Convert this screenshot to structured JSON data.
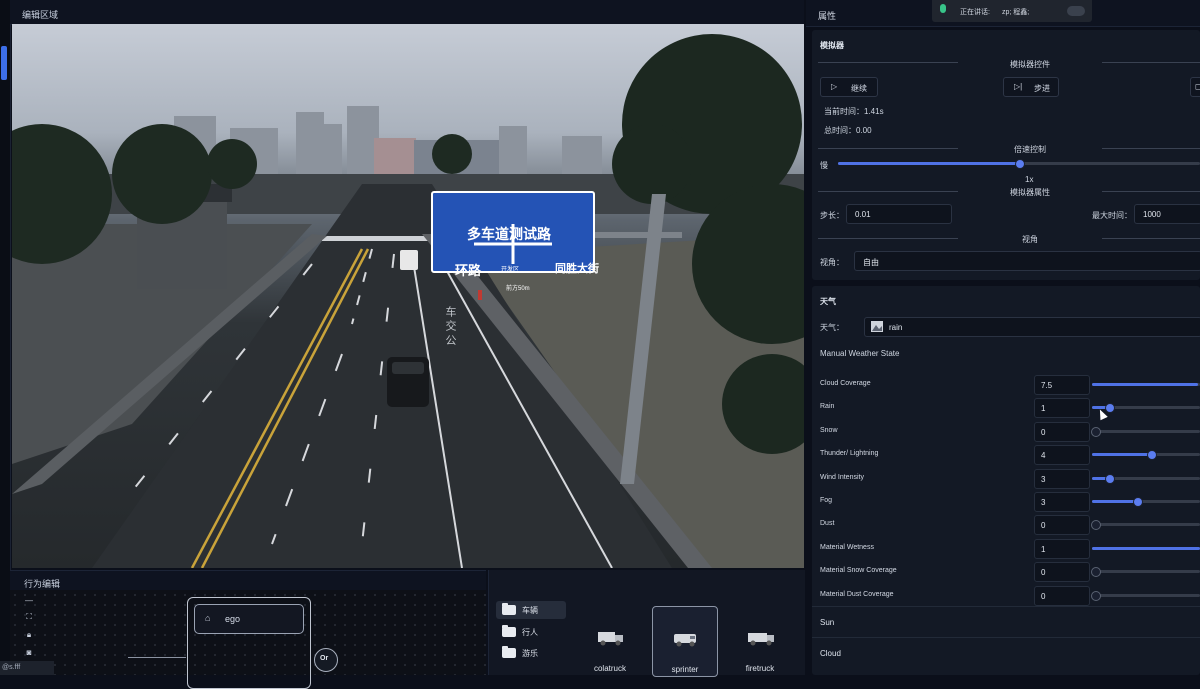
{
  "editor": {
    "title": "编辑区域"
  },
  "sign": {
    "title": "多车道测试路",
    "left": "环路",
    "right": "同胜大街",
    "center": "开发区",
    "bottom": "前方50m"
  },
  "road_text": "车 交 公",
  "behavior": {
    "title": "行为编辑",
    "node_label": "ego",
    "or_label": "Or",
    "tools": [
      "minus-icon",
      "fit-screen-icon",
      "lock-icon",
      "camera-icon"
    ]
  },
  "corner_tag": "@s.fff",
  "assets": {
    "categories": [
      {
        "label": "车辆",
        "selected": true
      },
      {
        "label": "行人",
        "selected": false
      },
      {
        "label": "游乐",
        "selected": false
      }
    ],
    "items": [
      {
        "name": "colatruck",
        "selected": false
      },
      {
        "name": "sprinter",
        "selected": true
      },
      {
        "name": "firetruck",
        "selected": false
      }
    ]
  },
  "properties": {
    "title": "属性",
    "speaking": {
      "label": "正在讲话:",
      "name": "zp; 程鑫;"
    }
  },
  "simulator": {
    "title": "模拟器",
    "controls_title": "模拟器控件",
    "continue_label": "继续",
    "step_label": "步进",
    "current_time": "当前时间：1.41s",
    "total_time": "总时间：0.00",
    "speed_title": "倍速控制",
    "slow_label": "慢",
    "speed_value": "1x",
    "speed_fraction": 0.5,
    "props_title": "模拟器属性",
    "step_size_label": "步长：",
    "step_size": "0.01",
    "max_time_label": "最大时间：",
    "max_time": "1000",
    "view_title": "视角",
    "view_label": "视角：",
    "view_value": "自由"
  },
  "weather": {
    "title": "天气",
    "weather_label": "天气：",
    "weather_value": "rain",
    "manual_title": "Manual Weather State",
    "params": [
      {
        "label": "Cloud Coverage",
        "value": "7.5",
        "fraction": 0.98
      },
      {
        "label": "Rain",
        "value": "1",
        "fraction": 0.16
      },
      {
        "label": "Snow",
        "value": "0",
        "fraction": 0.0
      },
      {
        "label": "Thunder/ Lightning",
        "value": "4",
        "fraction": 0.55
      },
      {
        "label": "Wind Intensity",
        "value": "3",
        "fraction": 0.16
      },
      {
        "label": "Fog",
        "value": "3",
        "fraction": 0.42
      },
      {
        "label": "Dust",
        "value": "0",
        "fraction": 0.0
      },
      {
        "label": "Material Wetness",
        "value": "1",
        "fraction": 1.0
      },
      {
        "label": "Material Snow Coverage",
        "value": "0",
        "fraction": 0.0
      },
      {
        "label": "Material Dust Coverage",
        "value": "0",
        "fraction": 0.0
      }
    ],
    "sun_label": "Sun",
    "cloud_label": "Cloud"
  }
}
